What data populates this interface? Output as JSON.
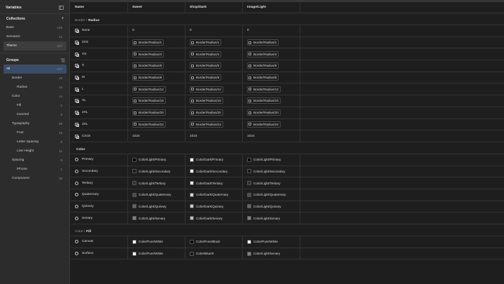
{
  "sidebar": {
    "title": "Variables",
    "collections_title": "Collections",
    "collections": [
      {
        "label": "Base",
        "count": "148"
      },
      {
        "label": "Semantic",
        "count": "12"
      },
      {
        "label": "Theme",
        "count": "107"
      }
    ],
    "groups_title": "Groups",
    "groups": [
      {
        "label": "All",
        "count": "107"
      },
      {
        "label": "Border",
        "count": "10"
      },
      {
        "label": "Radius",
        "count": "10"
      },
      {
        "label": "Color",
        "count": "14"
      },
      {
        "label": "Fill",
        "count": "2"
      },
      {
        "label": "Inverted",
        "count": "6"
      },
      {
        "label": "Typography",
        "count": "39"
      },
      {
        "label": "Font",
        "count": "19"
      },
      {
        "label": "Letter Spacing",
        "count": "9"
      },
      {
        "label": "Line Height",
        "count": "11"
      },
      {
        "label": "Spacing",
        "count": "9"
      },
      {
        "label": "iPhone",
        "count": "1"
      },
      {
        "label": "Component",
        "count": "35"
      }
    ]
  },
  "table": {
    "headers": [
      "Name",
      "Sweet",
      "Shop/Dark",
      "Image/Light"
    ],
    "group1": {
      "prefix": "Border /",
      "name": "Radius"
    },
    "radius_rows": [
      {
        "name": "None",
        "v": [
          "0",
          "0",
          "0"
        ]
      },
      {
        "name": "2XS",
        "v": [
          "Border/Radius/1",
          "Border/Radius/1",
          "Border/Radius/1"
        ]
      },
      {
        "name": "XS",
        "v": [
          "Border/Radius/4",
          "Border/Radius/4",
          "Border/Radius/4"
        ]
      },
      {
        "name": "S",
        "v": [
          "Border/Radius/6",
          "Border/Radius/6",
          "Border/Radius/6"
        ]
      },
      {
        "name": "M",
        "v": [
          "Border/Radius/8",
          "Border/Radius/8",
          "Border/Radius/8"
        ]
      },
      {
        "name": "L",
        "v": [
          "Border/Radius/12",
          "Border/Radius/12",
          "Border/Radius/12"
        ]
      },
      {
        "name": "XL",
        "v": [
          "Border/Radius/16",
          "Border/Radius/16",
          "Border/Radius/16"
        ]
      },
      {
        "name": "2XL",
        "v": [
          "Border/Radius/20",
          "Border/Radius/20",
          "Border/Radius/20"
        ]
      },
      {
        "name": "3XL",
        "v": [
          "Border/Radius/24",
          "Border/Radius/24",
          "Border/Radius/24"
        ]
      },
      {
        "name": "Circle",
        "v": [
          "1024",
          "1024",
          "1024"
        ]
      }
    ],
    "group2": {
      "name": "Color"
    },
    "color_rows": [
      {
        "name": "Primary",
        "v": [
          "Color/Light/Primary",
          "Color/Dark/Primary",
          "Color/Light/Primary"
        ],
        "c": [
          "#000000",
          "#ffffff",
          "#000000"
        ]
      },
      {
        "name": "Secondary",
        "v": [
          "Color/Light/Secondary",
          "Color/Dark/Secondary",
          "Color/Light/Secondary"
        ],
        "c": [
          "#1a1a1a",
          "#f2f2f2",
          "#1a1a1a"
        ]
      },
      {
        "name": "Tertiary",
        "v": [
          "Color/Light/Tertiary",
          "Color/Dark/Tertiary",
          "Color/Light/Tertiary"
        ],
        "c": [
          "#333333",
          "#e6e6e6",
          "#333333"
        ]
      },
      {
        "name": "Quaternary",
        "v": [
          "Color/Light/Quaternary",
          "Color/Dark/Quaternary",
          "Color/Light/Quaternary"
        ],
        "c": [
          "#4d4d4d",
          "#d9d9d9",
          "#4d4d4d"
        ]
      },
      {
        "name": "Quinary",
        "v": [
          "Color/Light/Quinary",
          "Color/Dark/Quinary",
          "Color/Light/Quinary"
        ],
        "c": [
          "#666666",
          "#cccccc",
          "#666666"
        ]
      },
      {
        "name": "Senary",
        "v": [
          "Color/Light/Senary",
          "Color/Dark/Senary",
          "Color/Light/Senary"
        ],
        "c": [
          "#808080",
          "#bfbfbf",
          "#808080"
        ]
      }
    ],
    "group3": {
      "prefix": "Color /",
      "name": "Fill"
    },
    "fill_rows": [
      {
        "name": "Canvas",
        "v": [
          "Color/Pure/White",
          "Color/Pure/Black",
          "Color/Pure/White"
        ],
        "c": [
          "#ffffff",
          "#000000",
          "#ffffff"
        ]
      },
      {
        "name": "Surface",
        "v": [
          "Color/Pure/White",
          "Color/Blue/0",
          "Color/Light/Senary"
        ],
        "c": [
          "#ffffff",
          "#0b1a2e",
          "#808080"
        ]
      }
    ]
  }
}
